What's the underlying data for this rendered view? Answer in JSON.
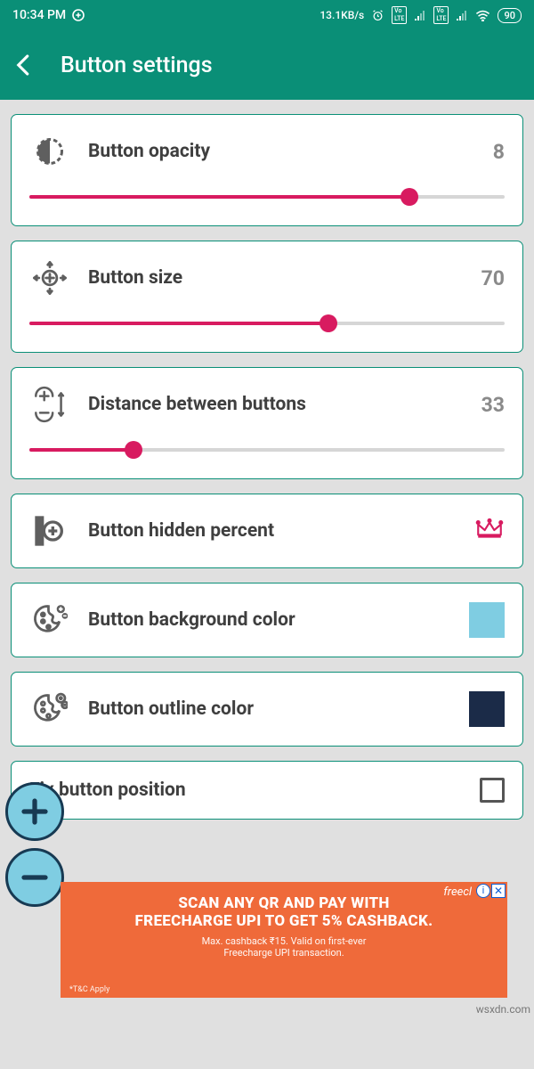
{
  "status": {
    "time": "10:34 PM",
    "speed": "13.1KB/s",
    "battery": "90"
  },
  "header": {
    "title": "Button settings"
  },
  "settings": {
    "opacity": {
      "label": "Button opacity",
      "value": "8",
      "percent": 80
    },
    "size": {
      "label": "Button size",
      "value": "70",
      "percent": 63
    },
    "distance": {
      "label": "Distance between buttons",
      "value": "33",
      "percent": 22
    },
    "hidden": {
      "label": "Button hidden percent"
    },
    "bgcolor": {
      "label": "Button background color",
      "swatch": "#7fcde2"
    },
    "outlinecolor": {
      "label": "Button outline color",
      "swatch": "#1b2b48"
    },
    "fixpos": {
      "label": "Fix button position",
      "checked": false
    }
  },
  "ad": {
    "brand": "freecl",
    "line1a": "SCAN ANY QR AND PAY WITH",
    "line1b": "FREECHARGE UPI TO GET 5% CASHBACK.",
    "line2": "Max. cashback ₹15. Valid on first-ever",
    "line3": "Freecharge UPI transaction.",
    "tc": "*T&C Apply"
  },
  "watermark": "wsxdn.com"
}
